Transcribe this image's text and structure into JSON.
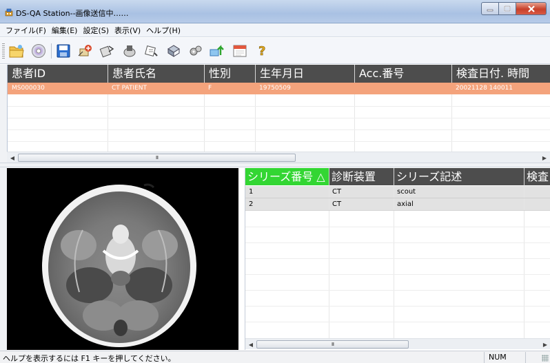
{
  "window": {
    "title": "DS-QA Station--画像送信中……",
    "controls": [
      "minimize",
      "maximize",
      "close"
    ]
  },
  "menu": [
    "ファイル(F)",
    "編集(E)",
    "設定(S)",
    "表示(V)",
    "ヘルプ(H)"
  ],
  "toolbar": {
    "icons": [
      "open-folder-icon",
      "cd-disc-icon",
      "save-disk-icon",
      "send-to-network-icon",
      "send-icon",
      "receive-icon",
      "query-icon",
      "print-icon",
      "settings-icon",
      "export-icon",
      "calendar-icon",
      "help-icon"
    ]
  },
  "patient_table": {
    "columns": [
      "患者ID",
      "患者氏名",
      "性別",
      "生年月日",
      "Acc.番号",
      "検査日付. 時間"
    ],
    "rows": [
      {
        "id": "MS000030",
        "name": "CT PATIENT",
        "sex": "F",
        "birth": "19750509",
        "acc": "",
        "study_datetime": "20021128 140011"
      }
    ],
    "selected_color": "#f4a37c",
    "scroll_thumb": "III"
  },
  "series_table": {
    "columns": [
      "シリーズ番号 △",
      "診断装置",
      "シリーズ記述",
      "検査"
    ],
    "rows": [
      {
        "number": "1",
        "modality": "CT",
        "description": "scout"
      },
      {
        "number": "2",
        "modality": "CT",
        "description": "axial"
      }
    ],
    "sorted_color": "#33d633",
    "scroll_thumb": "III"
  },
  "viewer": {
    "modality": "CT",
    "content": "axial-head-ct-image"
  },
  "status": {
    "help_text": "ヘルプを表示するには F1 キーを押してください。",
    "num_indicator": "NUM"
  },
  "colors": {
    "header_bg": "#4d4d4d",
    "selected_row": "#f4a37c",
    "sort_header": "#33d633"
  }
}
